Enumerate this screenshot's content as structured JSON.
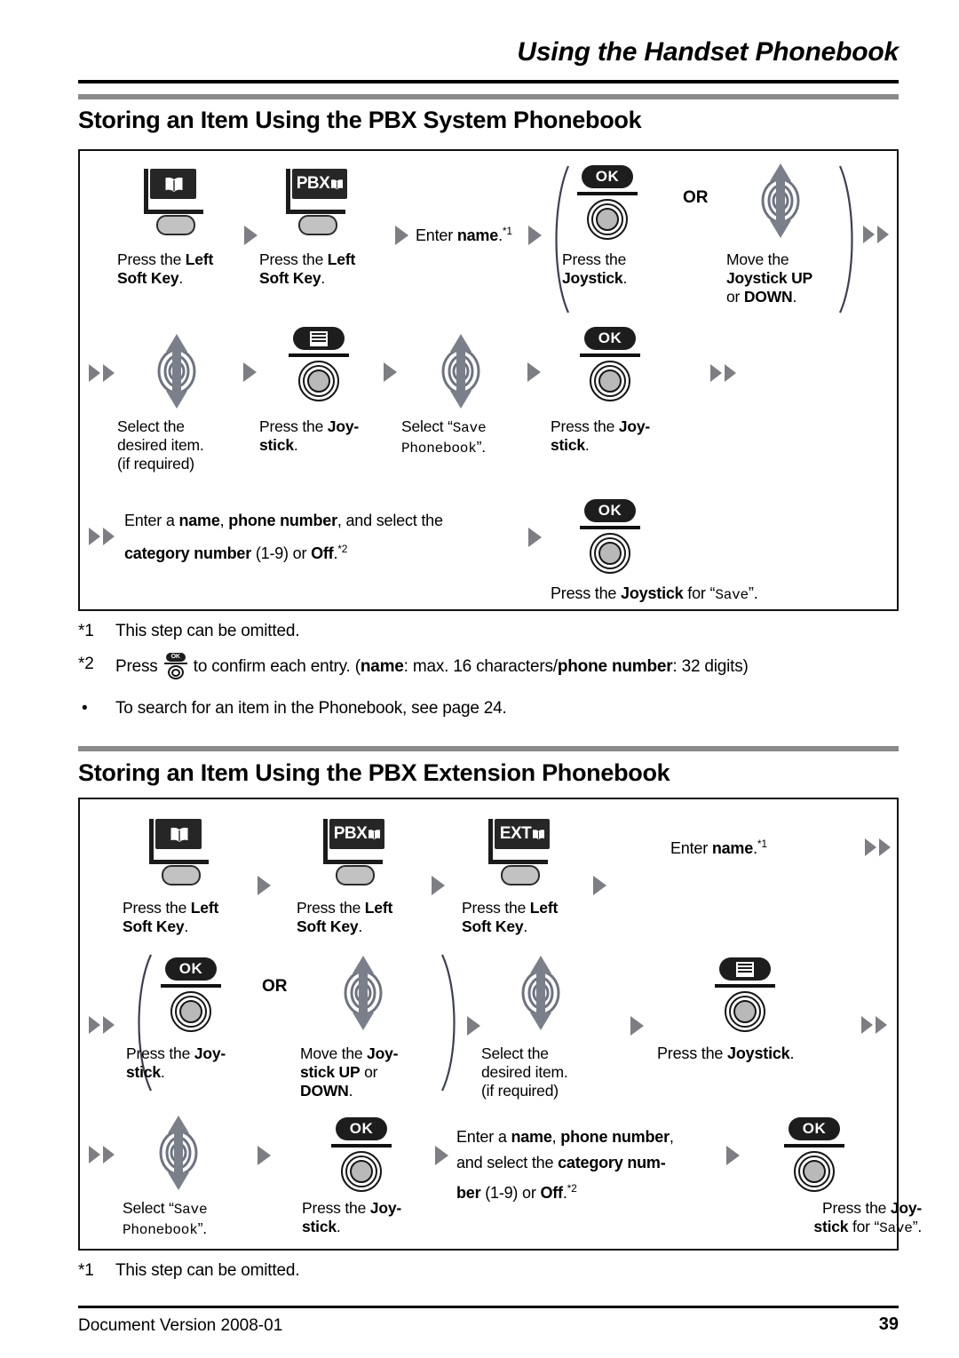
{
  "header": {
    "title": "Using the Handset Phonebook"
  },
  "sections": [
    {
      "title": "Storing an Item Using the PBX System Phonebook",
      "steps_row1": [
        {
          "icon": "phonebook-softkey-icon",
          "caption_plain": "Press the ",
          "caption_bold": "Left\nSoft Key",
          "caption_tail": "."
        },
        {
          "icon": "pbx-softkey-icon",
          "caption_plain": "Press the ",
          "caption_bold": "Left\nSoft Key",
          "caption_tail": "."
        }
      ],
      "enter_name": "Enter ",
      "enter_name_bold": "name",
      "enter_name_tail": ".",
      "enter_name_sup": "*1",
      "or_label": "OR",
      "press_joystick_caption_a": "Press the ",
      "press_joystick_caption_b": "Joystick",
      "press_joystick_caption_c": ".",
      "move_joystick_caption_a": "Move the ",
      "move_joystick_caption_b": "Joystick UP",
      "move_joystick_caption_c": "or ",
      "move_joystick_caption_d": "DOWN",
      "move_joystick_caption_e": ".",
      "select_item_caption": "Select the\ndesired item.\n(if required)",
      "press_joy_stick_a": "Press the ",
      "press_joy_stick_b": "Joy-\nstick",
      "press_joy_stick_c": ".",
      "select_save_a": "Select “",
      "select_save_b": "Save\nPhonebook",
      "select_save_c": "”.",
      "enter_line_1a": "Enter a ",
      "enter_line_1b": "name",
      "enter_line_1c": ", ",
      "enter_line_1d": "phone number",
      "enter_line_1e": ", and select the",
      "enter_line_2a": "category number",
      "enter_line_2b": " (1-9) or ",
      "enter_line_2c": "Off",
      "enter_line_2d": ".",
      "enter_line_2sup": "*2",
      "final_caption_a": "Press the ",
      "final_caption_b": "Joystick",
      "final_caption_c": " for “",
      "final_caption_d": "Save",
      "final_caption_e": "”.",
      "footnotes": [
        {
          "mark": "*1",
          "text": "This step can be omitted."
        },
        {
          "mark": "*2",
          "pre": "Press ",
          "post_a": " to confirm each entry. (",
          "post_b": "name",
          "post_c": ": max. 16 characters/",
          "post_d": "phone number",
          "post_e": ": 32 digits)"
        },
        {
          "mark": "•",
          "text": "To search for an item in the Phonebook, see page 24."
        }
      ]
    },
    {
      "title": "Storing an Item Using the PBX Extension Phonebook",
      "softkey_caption_a": "Press the ",
      "softkey_caption_b": "Left\nSoft Key",
      "softkey_caption_c": ".",
      "enter_name": "Enter ",
      "enter_name_bold": "name",
      "enter_name_tail": ".",
      "enter_name_sup": "*1",
      "or_label": "OR",
      "press_joy_a": "Press the ",
      "press_joy_b": "Joy-\nstick",
      "press_joy_c": ".",
      "move_joy_a": "Move the ",
      "move_joy_b": "Joy-\nstick UP",
      "move_joy_c": " or",
      "move_joy_d": "DOWN",
      "move_joy_e": ".",
      "select_item_caption": "Select the\ndesired item.\n(if required)",
      "press_joystick_full_a": "Press the ",
      "press_joystick_full_b": "Joystick",
      "press_joystick_full_c": ".",
      "select_save_a": "Select “",
      "select_save_b": "Save\nPhonebook",
      "select_save_c": "”.",
      "enter_line_1a": "Enter a ",
      "enter_line_1b": "name",
      "enter_line_1c": ", ",
      "enter_line_1d": "phone number",
      "enter_line_1e": ",",
      "enter_line_2a": "and select the ",
      "enter_line_2b": "category num-",
      "enter_line_3a": "ber",
      "enter_line_3b": " (1-9) or ",
      "enter_line_3c": "Off",
      "enter_line_3d": ".",
      "enter_line_3sup": "*2",
      "final_caption_a": "Press the ",
      "final_caption_b": "Joy-\nstick",
      "final_caption_c": " for “",
      "final_caption_d": "Save",
      "final_caption_e": "”.",
      "footnotes": [
        {
          "mark": "*1",
          "text": "This step can be omitted."
        }
      ]
    }
  ],
  "icons": {
    "phonebook_tag": "",
    "pbx_tag": "PBX",
    "ext_tag": "EXT",
    "ok_label": "OK"
  },
  "footer": {
    "left": "Document Version 2008-01",
    "page": "39"
  },
  "colors": {
    "ink": "#000000",
    "gray_rule": "#8a8a8a",
    "icon_dark": "#262626",
    "pill_gray": "#c2c2c2",
    "triangle_gray": "#7d7d84",
    "paren_navy": "#3c4050"
  }
}
